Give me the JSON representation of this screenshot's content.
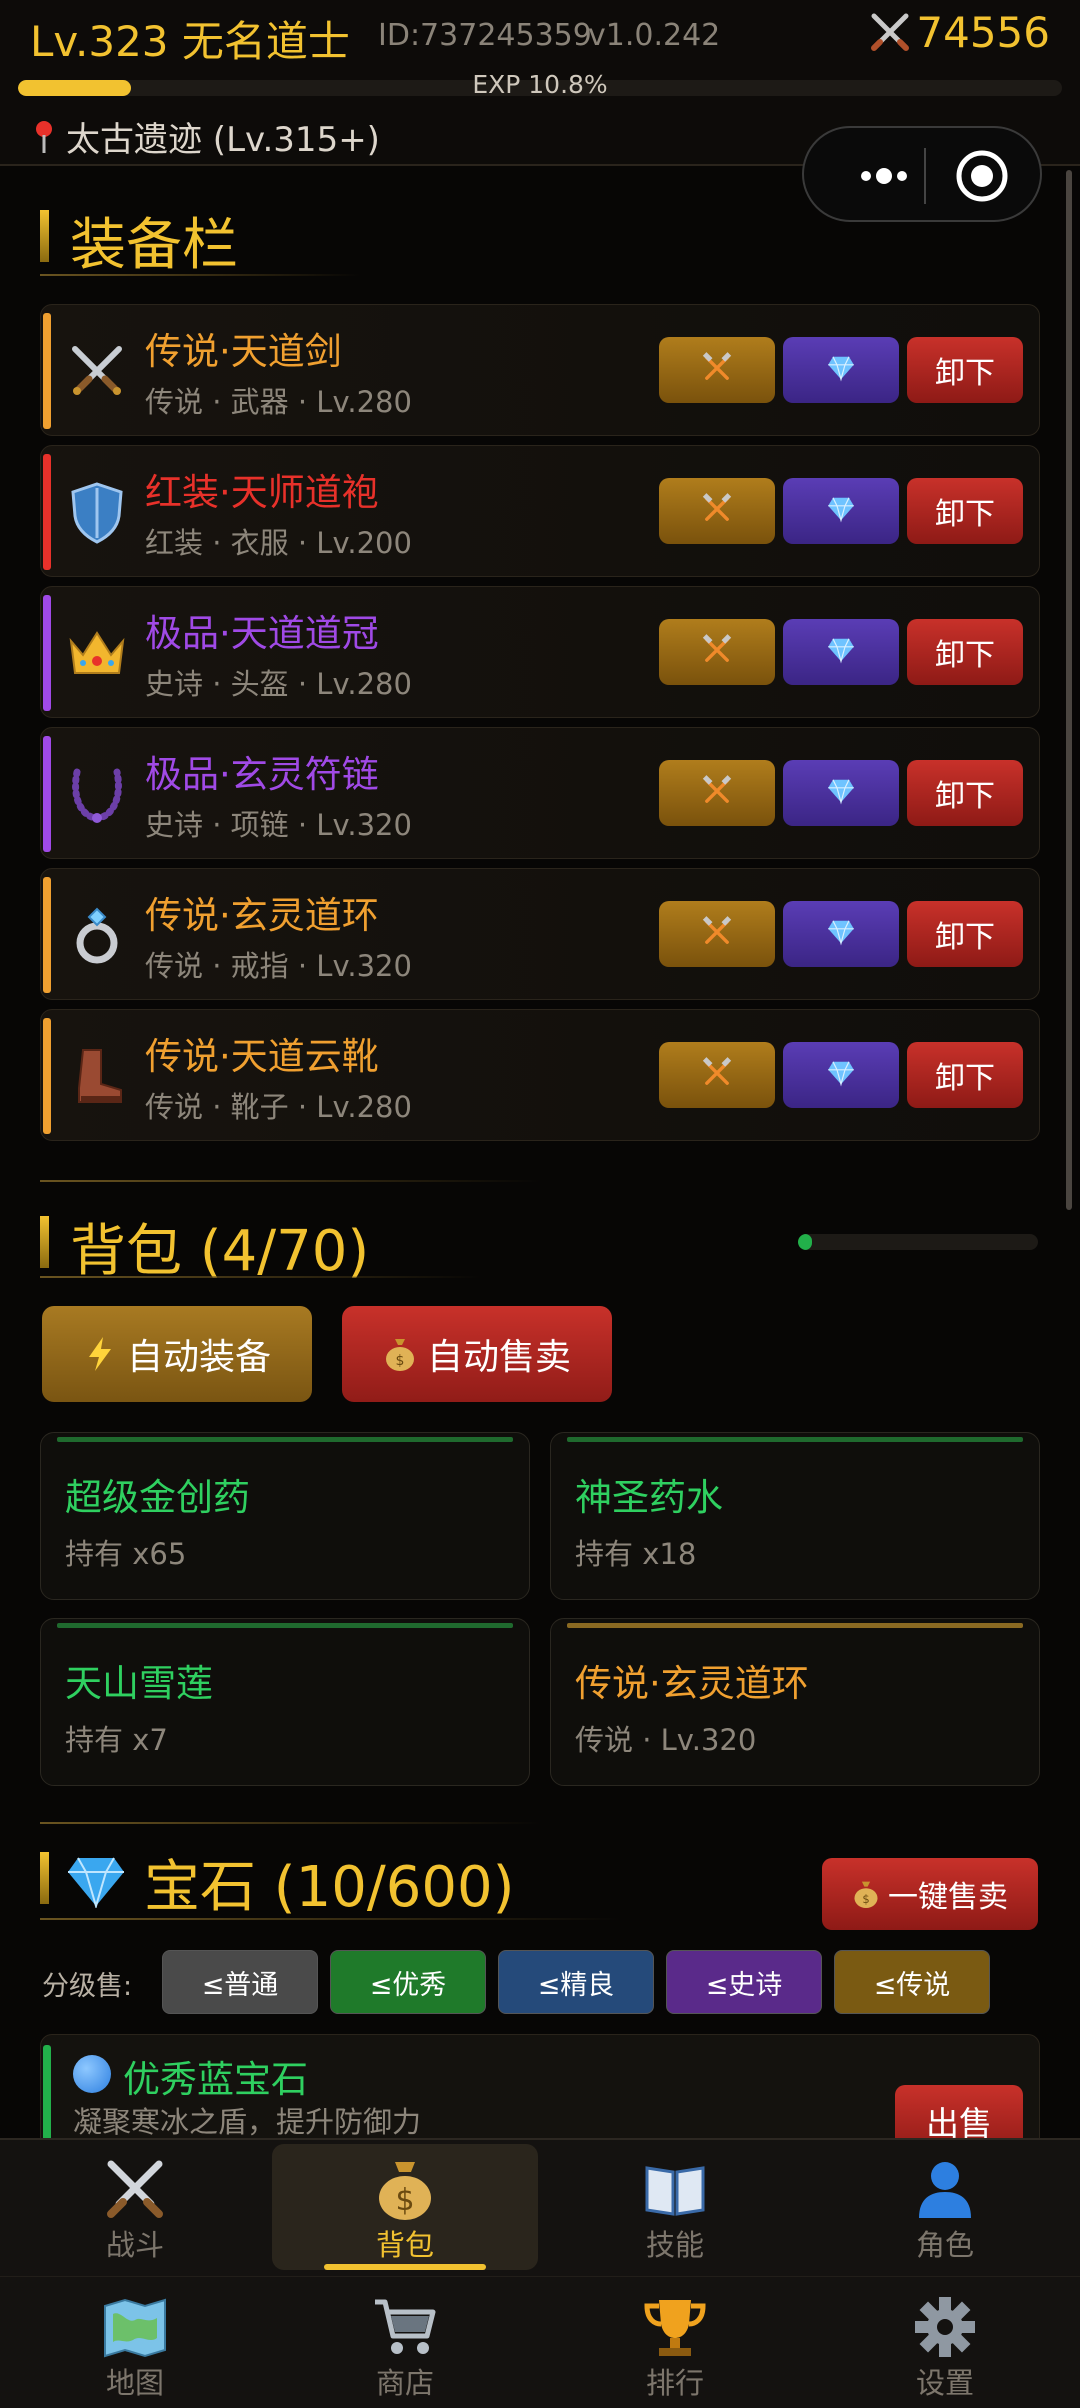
{
  "header": {
    "title": "Lv.323 无名道士",
    "id": "ID:737245359",
    "version": "v1.0.242",
    "power": "74556",
    "exp_text": "EXP 10.8%",
    "exp_fraction": 0.108,
    "location": "太古遗迹 (Lv.315+)"
  },
  "equipment": {
    "title": "装备栏",
    "unequip_label": "卸下",
    "items": [
      {
        "name": "传说·天道剑",
        "sub": "传说 · 武器 · Lv.280",
        "color": "#f0a030",
        "icon": "sword-icon"
      },
      {
        "name": "红装·天师道袍",
        "sub": "红装 · 衣服 · Lv.200",
        "color": "#e8312a",
        "icon": "shield-icon"
      },
      {
        "name": "极品·天道道冠",
        "sub": "史诗 · 头盔 · Lv.280",
        "color": "#a04ae6",
        "icon": "crown-icon"
      },
      {
        "name": "极品·玄灵符链",
        "sub": "史诗 · 项链 · Lv.320",
        "color": "#a04ae6",
        "icon": "necklace-icon"
      },
      {
        "name": "传说·玄灵道环",
        "sub": "传说 · 戒指 · Lv.320",
        "color": "#f0a030",
        "icon": "ring-icon"
      },
      {
        "name": "传说·天道云靴",
        "sub": "传说 · 靴子 · Lv.280",
        "color": "#f0a030",
        "icon": "boot-icon"
      }
    ]
  },
  "backpack": {
    "title": "背包 (4/70)",
    "fill_fraction": 0.057,
    "auto_equip": "自动装备",
    "auto_sell": "自动售卖",
    "items": [
      {
        "name": "超级金创药",
        "sub": "持有 x65",
        "color": "#2fd060"
      },
      {
        "name": "神圣药水",
        "sub": "持有 x18",
        "color": "#2fd060"
      },
      {
        "name": "天山雪莲",
        "sub": "持有 x7",
        "color": "#2fd060"
      },
      {
        "name": "传说·玄灵道环",
        "sub": "传说 · Lv.320",
        "color": "#f0a030"
      }
    ]
  },
  "gems": {
    "title": "宝石 (10/600)",
    "sell_all": "一键售卖",
    "grade_label": "分级售:",
    "grades": [
      "≤普通",
      "≤优秀",
      "≤精良",
      "≤史诗",
      "≤传说"
    ],
    "grade_colors": [
      "#4a4a4a",
      "#1f7a2a",
      "#254a7a",
      "#5a2a8a",
      "#7a5a12"
    ],
    "card": {
      "name": "优秀蓝宝石",
      "desc": "凝聚寒冰之盾，提升防御力",
      "sell": "出售"
    }
  },
  "nav": {
    "tabs": [
      {
        "label": "战斗",
        "icon": "crossed-swords-icon"
      },
      {
        "label": "背包",
        "icon": "money-bag-icon",
        "active": true
      },
      {
        "label": "技能",
        "icon": "book-icon"
      },
      {
        "label": "角色",
        "icon": "person-icon"
      },
      {
        "label": "地图",
        "icon": "map-icon"
      },
      {
        "label": "商店",
        "icon": "cart-icon"
      },
      {
        "label": "排行",
        "icon": "trophy-icon"
      },
      {
        "label": "设置",
        "icon": "gear-icon"
      }
    ]
  }
}
